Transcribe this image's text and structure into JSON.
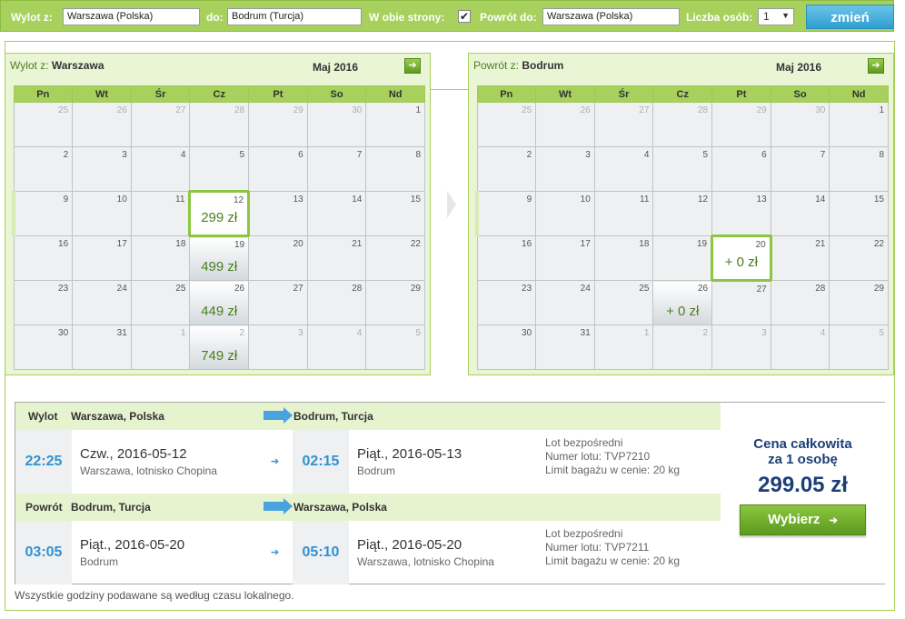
{
  "search": {
    "from_label": "Wylot z:",
    "from_value": "Warszawa (Polska)",
    "to_label": "do:",
    "to_value": "Bodrum (Turcja)",
    "roundtrip_label": "W obie strony:",
    "roundtrip_check": "✔",
    "return_label": "Powrót do:",
    "return_value": "Warszawa (Polska)",
    "persons_label": "Liczba osób:",
    "persons_value": "1",
    "change_button": "zmień"
  },
  "weekdays": [
    "Pn",
    "Wt",
    "Śr",
    "Cz",
    "Pt",
    "So",
    "Nd"
  ],
  "outbound_calendar": {
    "title_prefix": "Wylot z:",
    "title_city": "Warszawa",
    "month": "Maj 2016",
    "next_icon": "arrow-right-icon",
    "weeks": [
      [
        {
          "d": "25",
          "o": true
        },
        {
          "d": "26",
          "o": true
        },
        {
          "d": "27",
          "o": true
        },
        {
          "d": "28",
          "o": true
        },
        {
          "d": "29",
          "o": true
        },
        {
          "d": "30",
          "o": true
        },
        {
          "d": "1"
        }
      ],
      [
        {
          "d": "2"
        },
        {
          "d": "3"
        },
        {
          "d": "4"
        },
        {
          "d": "5"
        },
        {
          "d": "6"
        },
        {
          "d": "7"
        },
        {
          "d": "8"
        }
      ],
      [
        {
          "d": "9"
        },
        {
          "d": "10"
        },
        {
          "d": "11"
        },
        {
          "d": "12",
          "p": "299 zł",
          "s": true
        },
        {
          "d": "13"
        },
        {
          "d": "14"
        },
        {
          "d": "15"
        }
      ],
      [
        {
          "d": "16"
        },
        {
          "d": "17"
        },
        {
          "d": "18"
        },
        {
          "d": "19",
          "p": "499 zł"
        },
        {
          "d": "20"
        },
        {
          "d": "21"
        },
        {
          "d": "22"
        }
      ],
      [
        {
          "d": "23"
        },
        {
          "d": "24"
        },
        {
          "d": "25"
        },
        {
          "d": "26",
          "p": "449 zł"
        },
        {
          "d": "27"
        },
        {
          "d": "28"
        },
        {
          "d": "29"
        }
      ],
      [
        {
          "d": "30"
        },
        {
          "d": "31"
        },
        {
          "d": "1",
          "o": true
        },
        {
          "d": "2",
          "o": true,
          "p": "749 zł"
        },
        {
          "d": "3",
          "o": true
        },
        {
          "d": "4",
          "o": true
        },
        {
          "d": "5",
          "o": true
        }
      ]
    ]
  },
  "return_calendar": {
    "title_prefix": "Powrót z:",
    "title_city": "Bodrum",
    "month": "Maj 2016",
    "next_icon": "arrow-right-icon",
    "weeks": [
      [
        {
          "d": "25",
          "o": true
        },
        {
          "d": "26",
          "o": true
        },
        {
          "d": "27",
          "o": true
        },
        {
          "d": "28",
          "o": true
        },
        {
          "d": "29",
          "o": true
        },
        {
          "d": "30",
          "o": true
        },
        {
          "d": "1"
        }
      ],
      [
        {
          "d": "2"
        },
        {
          "d": "3"
        },
        {
          "d": "4"
        },
        {
          "d": "5"
        },
        {
          "d": "6"
        },
        {
          "d": "7"
        },
        {
          "d": "8"
        }
      ],
      [
        {
          "d": "9"
        },
        {
          "d": "10"
        },
        {
          "d": "11"
        },
        {
          "d": "12"
        },
        {
          "d": "13"
        },
        {
          "d": "14"
        },
        {
          "d": "15"
        }
      ],
      [
        {
          "d": "16"
        },
        {
          "d": "17"
        },
        {
          "d": "18"
        },
        {
          "d": "19"
        },
        {
          "d": "20",
          "p": "+ 0 zł",
          "s": true
        },
        {
          "d": "21"
        },
        {
          "d": "22"
        }
      ],
      [
        {
          "d": "23"
        },
        {
          "d": "24"
        },
        {
          "d": "25"
        },
        {
          "d": "26",
          "p": "+ 0 zł"
        },
        {
          "d": "27"
        },
        {
          "d": "28"
        },
        {
          "d": "29"
        }
      ],
      [
        {
          "d": "30"
        },
        {
          "d": "31"
        },
        {
          "d": "1",
          "o": true
        },
        {
          "d": "2",
          "o": true
        },
        {
          "d": "3",
          "o": true
        },
        {
          "d": "4",
          "o": true
        },
        {
          "d": "5",
          "o": true
        }
      ]
    ]
  },
  "outbound": {
    "label": "Wylot",
    "from": "Warszawa, Polska",
    "to": "Bodrum, Turcja",
    "dep_time": "22:25",
    "dep_day": "Czw.",
    "dep_date": ", 2016-05-12",
    "dep_place": "Warszawa, lotnisko Chopina",
    "arr_time": "02:15",
    "arr_day": "Piąt.",
    "arr_date": ", 2016-05-13",
    "arr_place": "Bodrum",
    "info_1": "Lot bezpośredni",
    "info_2": "Numer lotu: TVP7210",
    "info_3": "Limit bagażu w cenie: 20 kg"
  },
  "inbound": {
    "label": "Powrót",
    "from": "Bodrum, Turcja",
    "to": "Warszawa, Polska",
    "dep_time": "03:05",
    "dep_day": "Piąt.",
    "dep_date": ", 2016-05-20",
    "dep_place": "Bodrum",
    "arr_time": "05:10",
    "arr_day": "Piąt.",
    "arr_date": ", 2016-05-20",
    "arr_place": "Warszawa, lotnisko Chopina",
    "info_1": "Lot bezpośredni",
    "info_2": "Numer lotu: TVP7211",
    "info_3": "Limit bagażu w cenie: 20 kg"
  },
  "price": {
    "title_1": "Cena całkowita",
    "title_2": "za 1 osobę",
    "value": "299.05 zł",
    "select_button": "Wybierz",
    "select_arrow": "➔"
  },
  "footer_note": "Wszystkie godziny podawane są według czasu lokalnego.",
  "colors": {
    "accent_green": "#a7d05c",
    "price_blue": "#1d3f78",
    "time_blue": "#2f92d2"
  }
}
